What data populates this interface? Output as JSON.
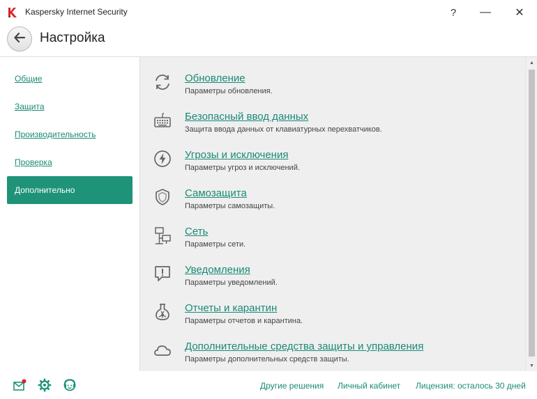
{
  "window": {
    "title": "Kaspersky Internet Security",
    "help_glyph": "?",
    "minimize_glyph": "—",
    "close_glyph": "✕"
  },
  "header": {
    "title": "Настройка"
  },
  "sidebar": {
    "items": [
      {
        "label": "Общие"
      },
      {
        "label": "Защита"
      },
      {
        "label": "Производительность"
      },
      {
        "label": "Проверка"
      },
      {
        "label": "Дополнительно",
        "active": true
      }
    ]
  },
  "settings": [
    {
      "icon": "update-icon",
      "title": "Обновление",
      "description": "Параметры обновления."
    },
    {
      "icon": "keyboard-icon",
      "title": "Безопасный ввод данных",
      "description": "Защита ввода данных от клавиатурных перехватчиков."
    },
    {
      "icon": "threats-icon",
      "title": "Угрозы и исключения",
      "description": "Параметры угроз и исключений."
    },
    {
      "icon": "self-defense-shield-icon",
      "title": "Самозащита",
      "description": "Параметры самозащиты."
    },
    {
      "icon": "network-icon",
      "title": "Сеть",
      "description": "Параметры сети."
    },
    {
      "icon": "notification-icon",
      "title": "Уведомления",
      "description": "Параметры уведомлений."
    },
    {
      "icon": "reports-quarantine-flask-icon",
      "title": "Отчеты и карантин",
      "description": "Параметры отчетов и карантина."
    },
    {
      "icon": "cloud-icon",
      "title": "Дополнительные средства защиты и управления",
      "description": "Параметры дополнительных средств защиты."
    }
  ],
  "footer": {
    "icons": [
      "mail-icon",
      "settings-gear-icon",
      "support-icon"
    ],
    "links": {
      "other_solutions": "Другие решения",
      "my_account": "Личный кабинет",
      "license": "Лицензия: осталось 30 дней"
    }
  },
  "colors": {
    "accent": "#1e9378",
    "link": "#1a8a76",
    "panel_bg": "#efefef",
    "logo_red": "#d8232a"
  }
}
